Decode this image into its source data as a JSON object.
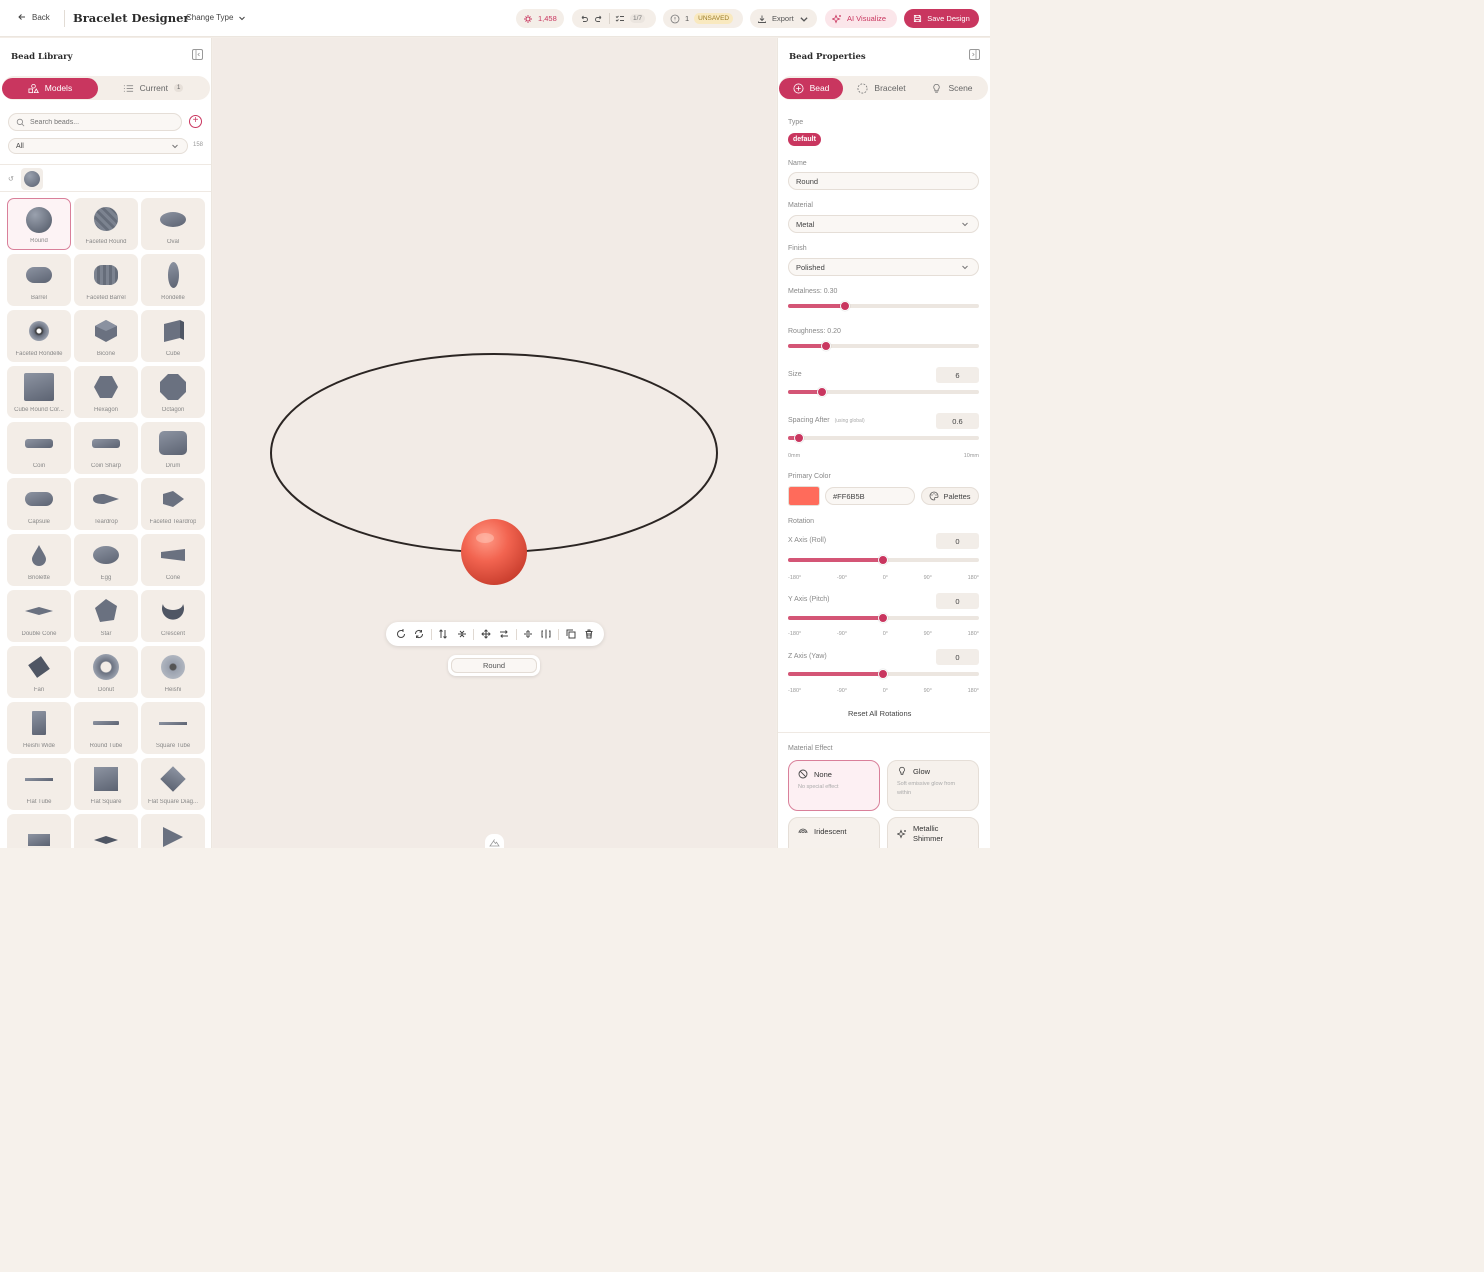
{
  "header": {
    "back_label": "Back",
    "title": "Bracelet Designer",
    "change_type_label": "Change Type",
    "credits": "1,458",
    "steps": "1/7",
    "issues_count": "1",
    "unsaved_label": "UNSAVED",
    "export_label": "Export",
    "ai_visualize_label": "AI Visualize",
    "save_label": "Save Design"
  },
  "library": {
    "title": "Bead Library",
    "tabs": [
      {
        "label": "Models",
        "icon": "shapes-icon",
        "active": true
      },
      {
        "label": "Current",
        "icon": "list-icon",
        "count": "1",
        "active": false
      }
    ],
    "search_placeholder": "Search beads...",
    "filter_value": "All",
    "filter_count": "158",
    "recent_icon": "history-icon",
    "beads": [
      {
        "label": "Round",
        "shape": "sphere",
        "selected": true
      },
      {
        "label": "Faceted Round",
        "shape": "faceted-sphere"
      },
      {
        "label": "Oval",
        "shape": "oval"
      },
      {
        "label": "Barrel",
        "shape": "barrel"
      },
      {
        "label": "Faceted Barrel",
        "shape": "faceted-barrel"
      },
      {
        "label": "Rondelle",
        "shape": "rondelle"
      },
      {
        "label": "Faceted Rondelle",
        "shape": "donut-small"
      },
      {
        "label": "Bicone",
        "shape": "bicone"
      },
      {
        "label": "Cube",
        "shape": "cube"
      },
      {
        "label": "Cube Round Cor...",
        "shape": "cube-big"
      },
      {
        "label": "Hexagon",
        "shape": "hexagon"
      },
      {
        "label": "Octagon",
        "shape": "octagon"
      },
      {
        "label": "Coin",
        "shape": "coin"
      },
      {
        "label": "Coin Sharp",
        "shape": "coin"
      },
      {
        "label": "Drum",
        "shape": "drum"
      },
      {
        "label": "Capsule",
        "shape": "capsule"
      },
      {
        "label": "Teardrop",
        "shape": "teardrop-h"
      },
      {
        "label": "Faceted Teardrop",
        "shape": "faceted-teardrop"
      },
      {
        "label": "Briolette",
        "shape": "briolette"
      },
      {
        "label": "Egg",
        "shape": "egg"
      },
      {
        "label": "Cone",
        "shape": "cone"
      },
      {
        "label": "Double Cone",
        "shape": "double-cone"
      },
      {
        "label": "Star",
        "shape": "star"
      },
      {
        "label": "Crescent",
        "shape": "crescent"
      },
      {
        "label": "Fan",
        "shape": "fan"
      },
      {
        "label": "Donut",
        "shape": "donut"
      },
      {
        "label": "Heishi",
        "shape": "heishi"
      },
      {
        "label": "Heishi Wide",
        "shape": "heishi-wide"
      },
      {
        "label": "Round Tube",
        "shape": "tube"
      },
      {
        "label": "Square Tube",
        "shape": "tube-thin"
      },
      {
        "label": "Flat Tube",
        "shape": "tube-thin"
      },
      {
        "label": "Flat Square",
        "shape": "square"
      },
      {
        "label": "Flat Square Diag...",
        "shape": "diamond"
      },
      {
        "label": "",
        "shape": "rect"
      },
      {
        "label": "",
        "shape": "flat-diamond"
      },
      {
        "label": "",
        "shape": "triangle"
      }
    ]
  },
  "canvas": {
    "selected_bead_label": "Round",
    "bead_color": "#FF6B5B",
    "string_color": "#2b2523",
    "toolbar_icons": [
      "rotate-icon",
      "refresh-icon",
      "flip-vertical-icon",
      "align-center-icon",
      "move-icon",
      "swap-icon",
      "distribute-icon",
      "mirror-icon",
      "duplicate-icon",
      "delete-icon"
    ]
  },
  "properties": {
    "title": "Bead Properties",
    "tabs": [
      {
        "label": "Bead",
        "icon": "plus-circle-icon",
        "active": true
      },
      {
        "label": "Bracelet",
        "icon": "dashed-circle-icon",
        "active": false
      },
      {
        "label": "Scene",
        "icon": "bulb-icon",
        "active": false
      }
    ],
    "type_label": "Type",
    "type_value": "default",
    "name_label": "Name",
    "name_value": "Round",
    "material_label": "Material",
    "material_value": "Metal",
    "finish_label": "Finish",
    "finish_value": "Polished",
    "metalness_label": "Metalness: 0.30",
    "metalness_value": 0.3,
    "roughness_label": "Roughness: 0.20",
    "roughness_value": 0.2,
    "size_label": "Size",
    "size_value": "6",
    "size_fraction": 0.18,
    "spacing_label": "Spacing After",
    "spacing_note": "(using global)",
    "spacing_value": "0.6",
    "spacing_fraction": 0.06,
    "spacing_min": "0mm",
    "spacing_max": "10mm",
    "primary_color_label": "Primary Color",
    "primary_color_value": "#FF6B5B",
    "palettes_label": "Palettes",
    "rotation_label": "Rotation",
    "x_axis_label": "X Axis (Roll)",
    "x_axis_value": "0",
    "y_axis_label": "Y Axis (Pitch)",
    "y_axis_value": "0",
    "z_axis_label": "Z Axis (Yaw)",
    "z_axis_value": "0",
    "rotation_ticks": [
      "-180°",
      "-90°",
      "0°",
      "90°",
      "180°"
    ],
    "reset_rotations_label": "Reset All Rotations",
    "material_effect_label": "Material Effect",
    "effects": [
      {
        "title": "None",
        "desc": "No special effect",
        "icon": "ban-icon",
        "selected": true
      },
      {
        "title": "Glow",
        "desc": "Soft emissive glow from within",
        "icon": "bulb-icon"
      },
      {
        "title": "Iridescent",
        "desc": "",
        "icon": "rainbow-icon"
      },
      {
        "title": "Metallic Shimmer",
        "desc": "",
        "icon": "sparkles-icon"
      }
    ]
  },
  "colors": {
    "accent": "#c9365f",
    "bead": "#FF6B5B"
  }
}
